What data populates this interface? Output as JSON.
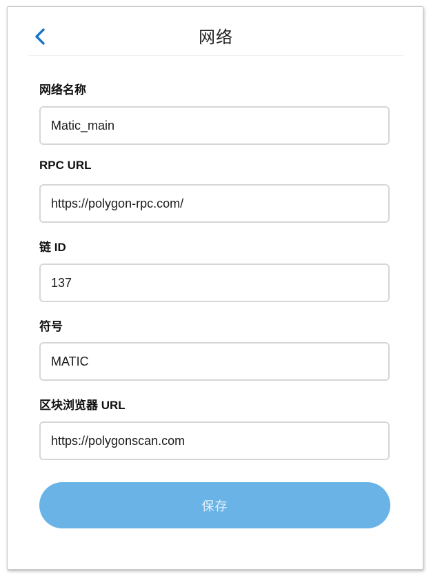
{
  "header": {
    "title": "网络",
    "back_icon": "chevron-left-icon",
    "accent_color": "#1a73c9"
  },
  "fields": {
    "network_name": {
      "label": "网络名称",
      "value": "Matic_main"
    },
    "rpc_url": {
      "label": "RPC URL",
      "value": "https://polygon-rpc.com/"
    },
    "chain_id": {
      "label": "链 ID",
      "value": "137"
    },
    "symbol": {
      "label": "符号",
      "value": "MATIC"
    },
    "explorer_url": {
      "label": "区块浏览器 URL",
      "value": "https://polygonscan.com"
    }
  },
  "save_button": {
    "label": "保存",
    "color": "#6ab3e6"
  }
}
